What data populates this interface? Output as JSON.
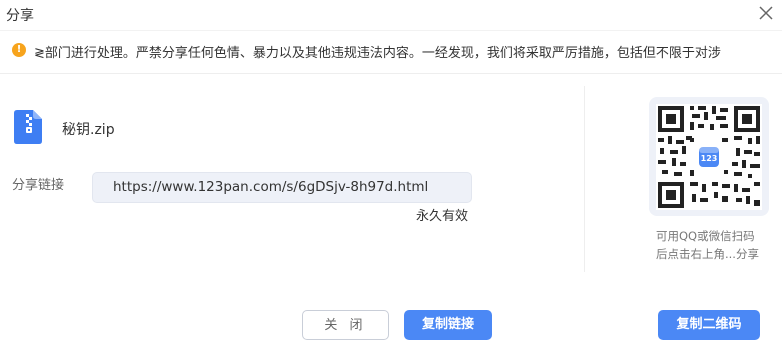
{
  "dialog": {
    "title": "分享"
  },
  "notice": {
    "text": "≷部门进行处理。严禁分享任何色情、暴力以及其他违规违法内容。一经发现，我们将采取严厉措施，包括但不限于对涉"
  },
  "file": {
    "name": "秘钥.zip",
    "icon": "zip-file-icon"
  },
  "share": {
    "label": "分享链接",
    "url": "https://www.123pan.com/s/6gDSjv-8h97d.html",
    "validity": "永久有效"
  },
  "qr": {
    "center_badge": "123",
    "hint": "可用QQ或微信扫码后点击右上角...分享"
  },
  "buttons": {
    "close": "关 闭",
    "copy_link": "复制链接",
    "copy_qr": "复制二维码"
  },
  "colors": {
    "primary": "#4b88f5",
    "warning": "#f7a41d",
    "link_box_bg": "#eef1f8"
  }
}
